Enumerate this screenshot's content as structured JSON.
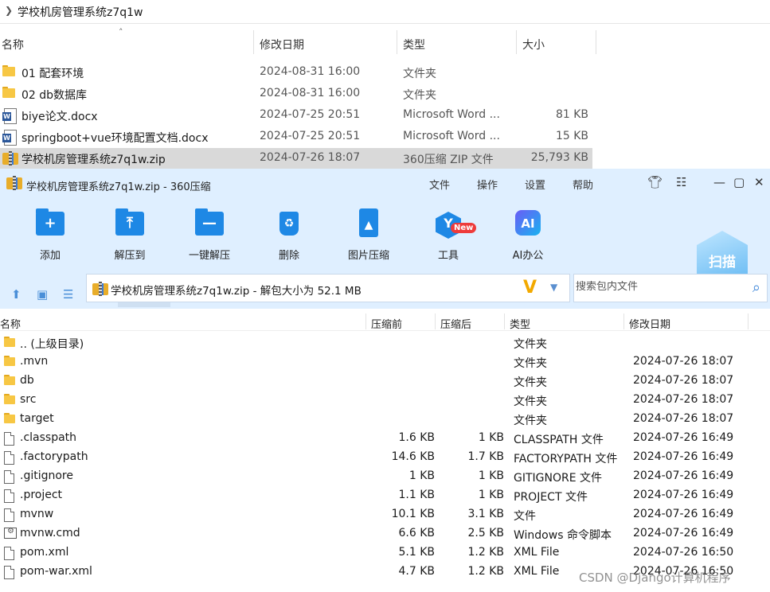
{
  "explorer": {
    "address_path": "学校机房管理系统z7q1w",
    "columns": {
      "name": "名称",
      "date": "修改日期",
      "type": "类型",
      "size": "大小"
    },
    "rows": [
      {
        "icon": "folder-icon",
        "name": "01 配套环境",
        "date": "2024-08-31 16:00",
        "type": "文件夹",
        "size": ""
      },
      {
        "icon": "folder-icon",
        "name": "02 db数据库",
        "date": "2024-08-31 16:00",
        "type": "文件夹",
        "size": ""
      },
      {
        "icon": "word-doc-icon",
        "name": "biye论文.docx",
        "date": "2024-07-25 20:51",
        "type": "Microsoft Word ...",
        "size": "81 KB"
      },
      {
        "icon": "word-doc-icon",
        "name": "springboot+vue环境配置文档.docx",
        "date": "2024-07-25 20:51",
        "type": "Microsoft Word ...",
        "size": "15 KB"
      },
      {
        "icon": "zip-archive-icon",
        "name": "学校机房管理系统z7q1w.zip",
        "date": "2024-07-26 18:07",
        "type": "360压缩 ZIP 文件",
        "size": "25,793 KB",
        "selected": true
      }
    ]
  },
  "zip": {
    "title": "学校机房管理系统z7q1w.zip - 360压缩",
    "menu": [
      "文件",
      "操作",
      "设置",
      "帮助"
    ],
    "toolbar": {
      "add": "添加",
      "extract_to": "解压到",
      "one_click_extract": "一键解压",
      "delete": "删除",
      "image_compress": "图片压缩",
      "tools": "工具",
      "tools_badge": "New",
      "ai_office": "AI办公",
      "ai_glyph": "AI",
      "scan": "扫描"
    },
    "path_text": "学校机房管理系统z7q1w.zip - 解包大小为 52.1 MB",
    "search_placeholder": "搜索包内文件",
    "columns": {
      "name": "名称",
      "compressed": "压缩前",
      "original": "压缩后",
      "type": "类型",
      "date": "修改日期"
    },
    "rows": [
      {
        "icon": "folder-icon",
        "name": ".. (上级目录)",
        "before": "",
        "after": "",
        "type": "文件夹",
        "date": ""
      },
      {
        "icon": "folder-icon",
        "name": ".mvn",
        "before": "",
        "after": "",
        "type": "文件夹",
        "date": "2024-07-26 18:07"
      },
      {
        "icon": "folder-icon",
        "name": "db",
        "before": "",
        "after": "",
        "type": "文件夹",
        "date": "2024-07-26 18:07"
      },
      {
        "icon": "folder-icon",
        "name": "src",
        "before": "",
        "after": "",
        "type": "文件夹",
        "date": "2024-07-26 18:07"
      },
      {
        "icon": "folder-icon",
        "name": "target",
        "before": "",
        "after": "",
        "type": "文件夹",
        "date": "2024-07-26 18:07"
      },
      {
        "icon": "file-icon",
        "name": ".classpath",
        "before": "1.6 KB",
        "after": "1 KB",
        "type": "CLASSPATH 文件",
        "date": "2024-07-26 16:49"
      },
      {
        "icon": "file-icon",
        "name": ".factorypath",
        "before": "14.6 KB",
        "after": "1.7 KB",
        "type": "FACTORYPATH 文件",
        "date": "2024-07-26 16:49"
      },
      {
        "icon": "file-icon",
        "name": ".gitignore",
        "before": "1 KB",
        "after": "1 KB",
        "type": "GITIGNORE 文件",
        "date": "2024-07-26 16:49"
      },
      {
        "icon": "file-icon",
        "name": ".project",
        "before": "1.1 KB",
        "after": "1 KB",
        "type": "PROJECT 文件",
        "date": "2024-07-26 16:49"
      },
      {
        "icon": "file-icon",
        "name": "mvnw",
        "before": "10.1 KB",
        "after": "3.1 KB",
        "type": "文件",
        "date": "2024-07-26 16:49"
      },
      {
        "icon": "cmd-script-icon",
        "name": "mvnw.cmd",
        "before": "6.6 KB",
        "after": "2.5 KB",
        "type": "Windows 命令脚本",
        "date": "2024-07-26 16:49"
      },
      {
        "icon": "file-icon",
        "name": "pom.xml",
        "before": "5.1 KB",
        "after": "1.2 KB",
        "type": "XML File",
        "date": "2024-07-26 16:50"
      },
      {
        "icon": "file-icon",
        "name": "pom-war.xml",
        "before": "4.7 KB",
        "after": "1.2 KB",
        "type": "XML File",
        "date": "2024-07-26 16:50"
      }
    ]
  },
  "watermark": "CSDN @Django计算机程序"
}
